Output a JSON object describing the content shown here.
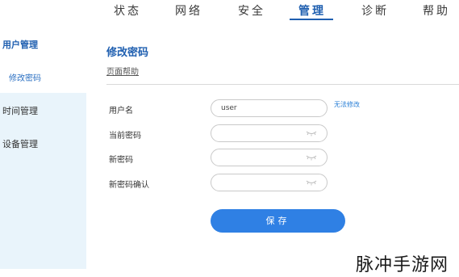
{
  "nav": {
    "items": [
      "状态",
      "网络",
      "安全",
      "管理",
      "诊断",
      "帮助"
    ],
    "active": "管理"
  },
  "sidebar": {
    "items": [
      {
        "label": "用户管理",
        "state": "group-active"
      },
      {
        "label": "修改密码",
        "state": "sub-active"
      },
      {
        "label": "时间管理",
        "state": "normal"
      },
      {
        "label": "设备管理",
        "state": "normal"
      }
    ]
  },
  "main": {
    "title": "修改密码",
    "help_link": "页面帮助",
    "fields": [
      {
        "label": "用户名",
        "value": "user"
      },
      {
        "label": "当前密码",
        "value": ""
      },
      {
        "label": "新密码",
        "value": ""
      },
      {
        "label": "新密码确认",
        "value": ""
      }
    ],
    "no_modify": "无法修改",
    "save_label": "保存"
  },
  "watermark": "脉冲手游网",
  "colors": {
    "accent": "#1f5fb0",
    "button": "#2f80e4",
    "sidebar_bg": "#e9f4fb"
  }
}
